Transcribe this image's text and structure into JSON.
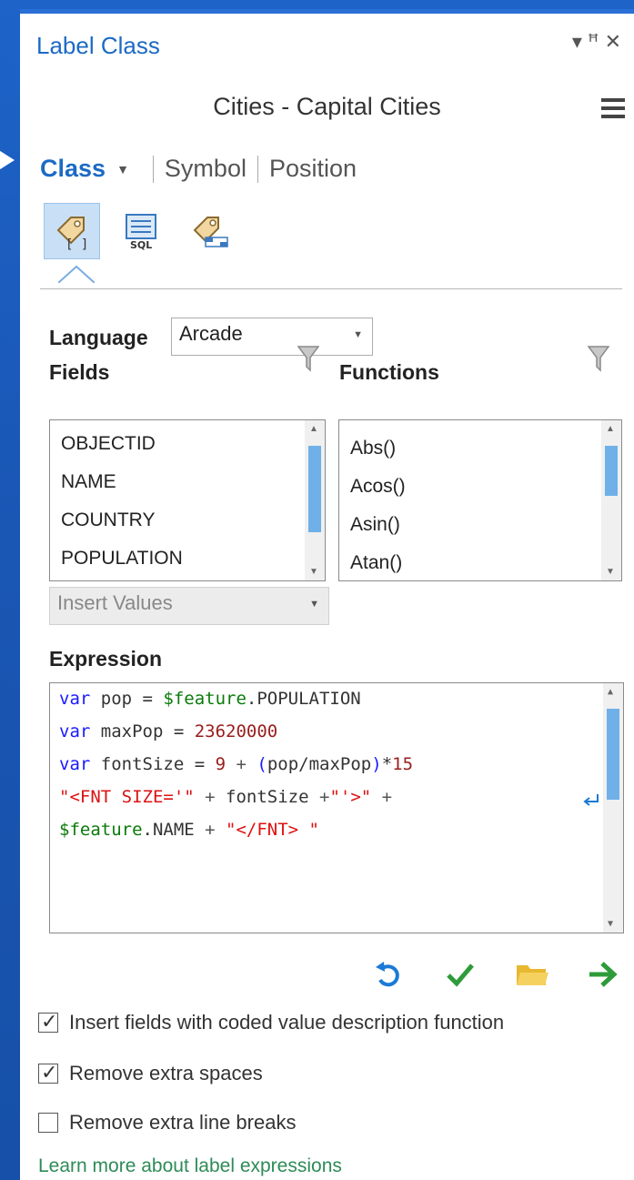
{
  "pane": {
    "title": "Label Class",
    "controls": "▾ ⊥ ✕",
    "layer_title": "Cities - Capital Cities"
  },
  "tabs": {
    "class": "Class",
    "symbol": "Symbol",
    "position": "Position"
  },
  "modes": [
    {
      "name": "label-expression",
      "icon": "tag-brackets-icon",
      "active": true
    },
    {
      "name": "sql-query",
      "icon": "sql-icon",
      "active": false
    },
    {
      "name": "label-placement",
      "icon": "tag-scale-icon",
      "active": false
    }
  ],
  "language": {
    "label": "Language",
    "value": "Arcade"
  },
  "fields": {
    "label": "Fields",
    "items": [
      "OBJECTID",
      "NAME",
      "COUNTRY",
      "POPULATION"
    ]
  },
  "functions": {
    "label": "Functions",
    "items": [
      "Abs()",
      "Acos()",
      "Asin()",
      "Atan()"
    ]
  },
  "insert_values": {
    "value": "Insert Values"
  },
  "expression": {
    "label": "Expression",
    "lines": [
      "var pop = $feature.POPULATION",
      "var maxPop = 23620000",
      "var fontSize = 9 + (pop/maxPop)*15",
      "\"<FNT SIZE='\" + fontSize +\"'>\" +",
      "$feature.NAME + \"</FNT> \""
    ]
  },
  "options": [
    {
      "label": "Insert fields with coded value description function",
      "checked": true
    },
    {
      "label": "Remove extra spaces",
      "checked": true
    },
    {
      "label": "Remove extra line breaks",
      "checked": false
    }
  ],
  "learn_more": "Learn more about label expressions",
  "colors": {
    "accent": "#1c6ac4",
    "background": "#1d63c8",
    "link": "#2e8b57",
    "scroll_thumb": "#6fb0e8"
  }
}
